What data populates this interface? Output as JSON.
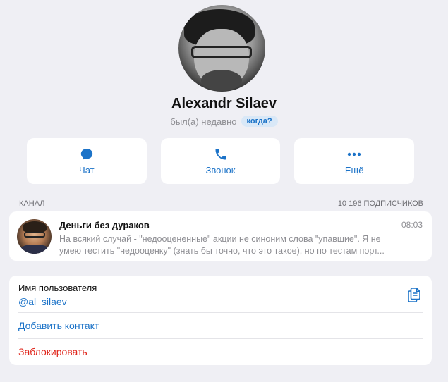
{
  "profile": {
    "name": "Alexandr Silaev",
    "status": "был(а) недавно",
    "when_badge": "когда?"
  },
  "actions": [
    {
      "label": "Чат",
      "icon": "chat-bubble-icon"
    },
    {
      "label": "Звонок",
      "icon": "phone-icon"
    },
    {
      "label": "Ещё",
      "icon": "more-dots-icon"
    }
  ],
  "channel_section": {
    "header": "КАНАЛ",
    "subscribers": "10 196 ПОДПИСЧИКОВ"
  },
  "channel": {
    "title": "Деньги без дураков",
    "time": "08:03",
    "preview_line1": "На всякий случай - \"недооцененные\" акции не синоним слова \"упавшие\". Я не",
    "preview_line2": "умею тестить \"недооценку\" (знать бы точно, что это такое), но по тестам порт..."
  },
  "info": {
    "username_label": "Имя пользователя",
    "username": "@al_silaev",
    "add_contact": "Добавить контакт",
    "block": "Заблокировать"
  },
  "colors": {
    "accent": "#1c73c8",
    "danger": "#e0261c",
    "background": "#efeff4"
  }
}
